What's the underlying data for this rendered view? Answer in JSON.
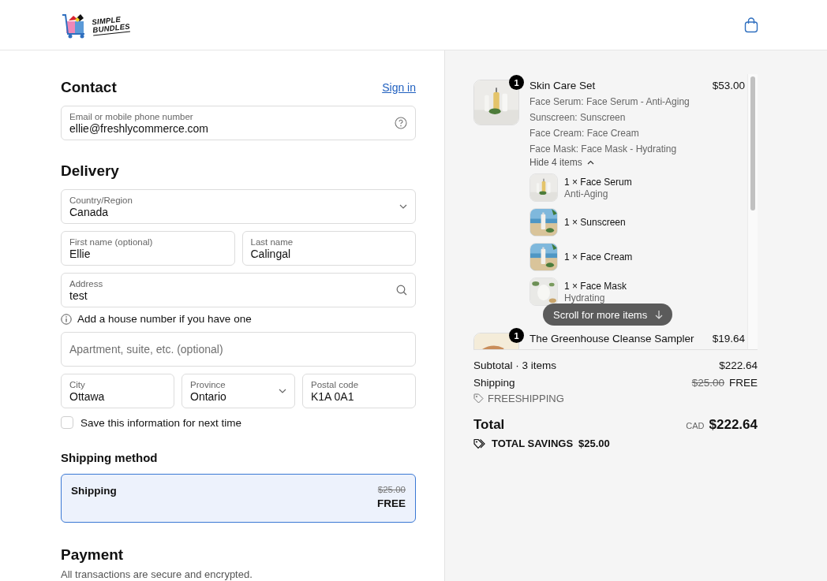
{
  "header": {
    "brand": [
      "SIMPLE",
      "BUNDLES"
    ]
  },
  "contact": {
    "title": "Contact",
    "sign_in": "Sign in",
    "email": {
      "kind": "help",
      "label": "Email or mobile phone number",
      "value": "ellie@freshlycommerce.com"
    }
  },
  "delivery": {
    "title": "Delivery",
    "rows": [
      {
        "kind": "fields",
        "fields": [
          {
            "kind": "select",
            "label": "Country/Region",
            "value": "Canada"
          }
        ]
      },
      {
        "kind": "fields",
        "fields": [
          {
            "kind": "text",
            "label": "First name (optional)",
            "value": "Ellie"
          },
          {
            "kind": "text",
            "label": "Last name",
            "value": "Calingal"
          }
        ]
      },
      {
        "kind": "fields",
        "fields": [
          {
            "kind": "search",
            "label": "Address",
            "value": "test"
          }
        ]
      },
      {
        "kind": "hint",
        "text": "Add a house number if you have one"
      },
      {
        "kind": "fields",
        "fields": [
          {
            "kind": "empty",
            "placeholder": "Apartment, suite, etc. (optional)"
          }
        ]
      },
      {
        "kind": "fields",
        "fields": [
          {
            "kind": "text",
            "label": "City",
            "value": "Ottawa"
          },
          {
            "kind": "select",
            "label": "Province",
            "value": "Ontario"
          },
          {
            "kind": "text",
            "label": "Postal code",
            "value": "K1A 0A1"
          }
        ]
      }
    ],
    "save_info": {
      "label": "Save this information for next time",
      "checked": false
    }
  },
  "shipping_method": {
    "title": "Shipping method",
    "options": [
      {
        "name": "Shipping",
        "original_price": "$25.00",
        "price": "FREE",
        "selected": true
      }
    ]
  },
  "payment": {
    "title": "Payment",
    "subtitle": "All transactions are secure and encrypted."
  },
  "summary": {
    "items": [
      {
        "quantity": "1",
        "title": "Skin Care Set",
        "price": "$53.00",
        "properties": [
          "Face Serum: Face Serum - Anti-Aging",
          "Sunscreen: Sunscreen",
          "Face Cream: Face Cream",
          "Face Mask: Face Mask - Hydrating"
        ],
        "toggle": "Hide 4 items",
        "expanded": true,
        "components": [
          {
            "title": "1 × Face Serum",
            "variant": "Anti-Aging"
          },
          {
            "title": "1 × Sunscreen"
          },
          {
            "title": "1 × Face Cream"
          },
          {
            "title": "1 × Face Mask",
            "variant": "Hydrating"
          }
        ]
      },
      {
        "quantity": "1",
        "title": "The Greenhouse Cleanse Sampler",
        "price": "$19.64"
      }
    ],
    "scroll_hint": "Scroll for more items",
    "subtotal_label": "Subtotal · 3 items",
    "subtotal": "$222.64",
    "shipping_label": "Shipping",
    "shipping_original": "$25.00",
    "shipping": "FREE",
    "discount_code": "FREESHIPPING",
    "total_label": "Total",
    "currency": "CAD",
    "total": "$222.64",
    "savings_label": "TOTAL SAVINGS",
    "savings": "$25.00"
  }
}
